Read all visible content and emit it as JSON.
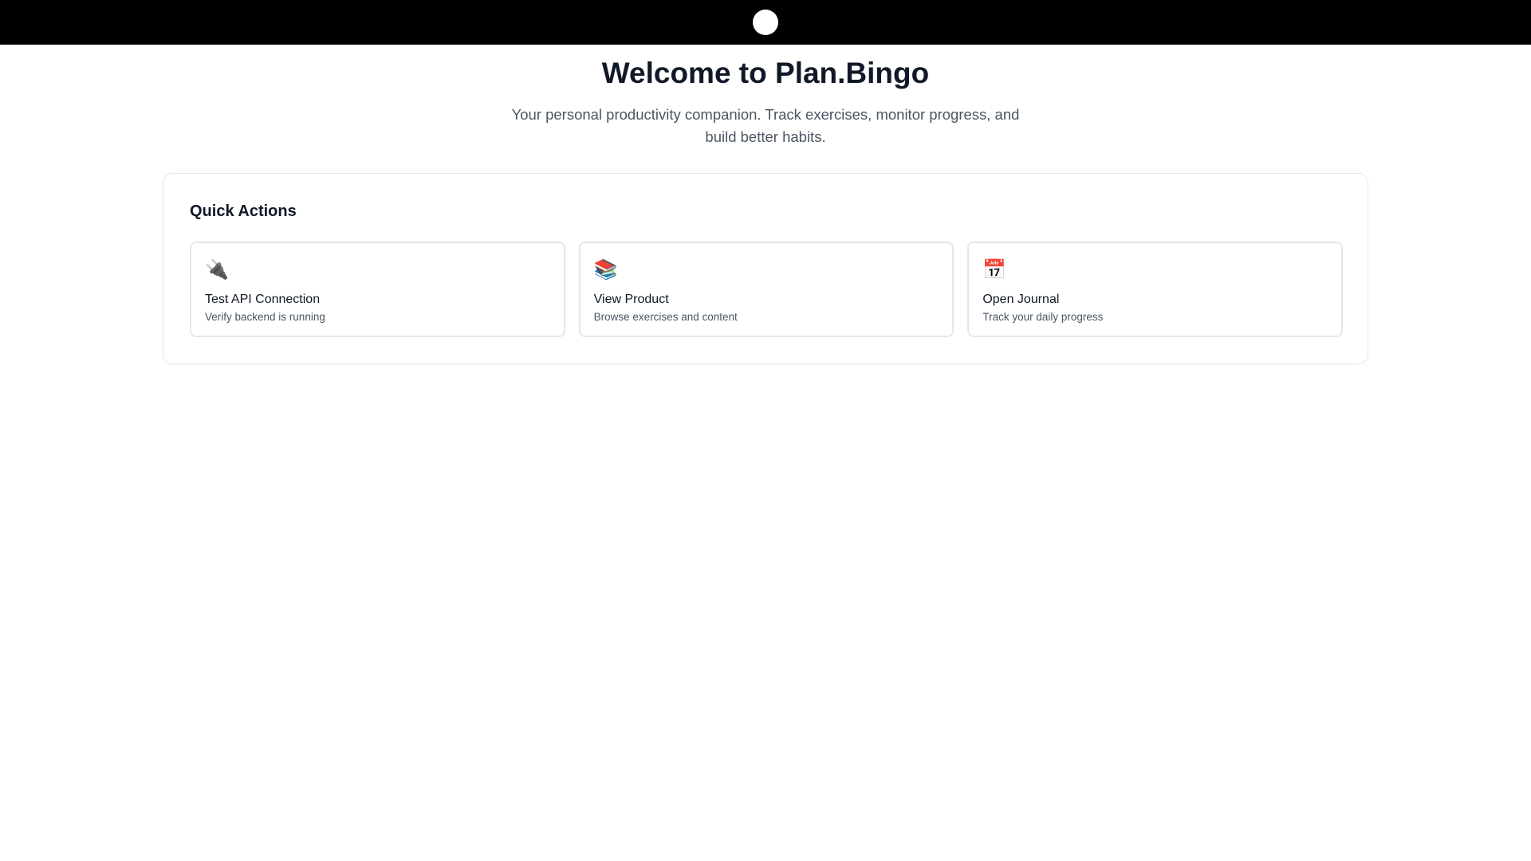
{
  "header": {
    "logo_icon": "circle-logo-icon",
    "background": "#000000",
    "logo_color": "#ffffff"
  },
  "hero": {
    "title": "Welcome to Plan.Bingo",
    "subtitle": "Your personal productivity companion. Track exercises, monitor progress, and build better habits."
  },
  "quick_actions": {
    "heading": "Quick Actions",
    "cards": [
      {
        "icon": "plug-icon",
        "glyph": "🔌",
        "title": "Test API Connection",
        "description": "Verify backend is running"
      },
      {
        "icon": "books-icon",
        "glyph": "📚",
        "title": "View Product",
        "description": "Browse exercises and content"
      },
      {
        "icon": "calendar-icon",
        "glyph": "📅",
        "title": "Open Journal",
        "description": "Track your daily progress"
      }
    ]
  },
  "colors": {
    "text_primary": "#111827",
    "text_secondary": "#4b5563",
    "border": "#e5e7eb"
  }
}
